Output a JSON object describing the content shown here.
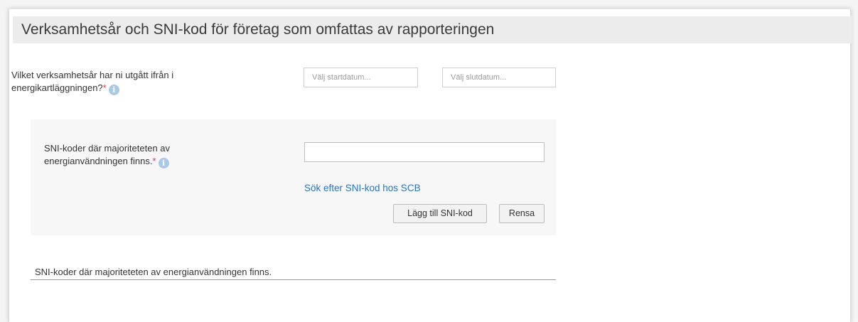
{
  "section": {
    "title": "Verksamhetsår och SNI-kod för företag som omfattas av rapporteringen"
  },
  "fiscal_year": {
    "label_line1": "Vilket verksamhetsår har ni utgått ifrån i",
    "label_line2": "energikartläggningen?",
    "required_marker": "*",
    "info_icon": "info-icon",
    "start_placeholder": "Välj startdatum...",
    "end_placeholder": "Välj slutdatum..."
  },
  "sni": {
    "label_line1": "SNI-koder där majoriteteten av",
    "label_line2": "energianvändningen finns.",
    "required_marker": "*",
    "info_icon": "info-icon",
    "input_value": "",
    "search_link": "Sök efter SNI-kod hos SCB",
    "add_button": "Lägg till SNI-kod",
    "clear_button": "Rensa"
  },
  "list": {
    "header": "SNI-koder där majoriteteten av energianvändningen finns."
  },
  "colors": {
    "header_bg": "#ececec",
    "required": "#e0305a",
    "link": "#2a74c4",
    "info_icon": "#a9c8ea"
  }
}
